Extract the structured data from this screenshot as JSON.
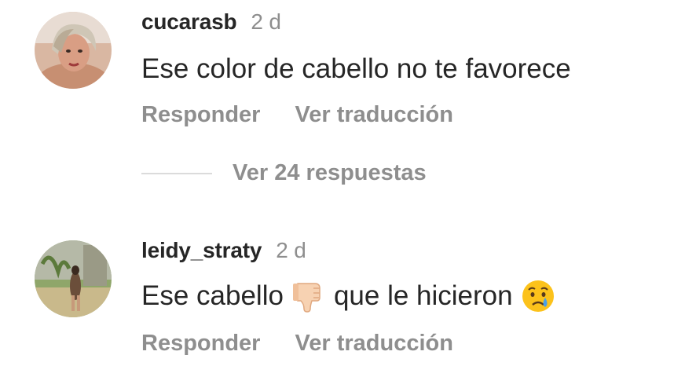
{
  "comments": [
    {
      "username": "cucarasb",
      "time": "2 d",
      "text": "Ese color de cabello no te favorece",
      "reply_label": "Responder",
      "translate_label": "Ver traducción"
    },
    {
      "username": "leidy_straty",
      "time": "2 d",
      "text_before": "Ese cabello",
      "emoji_1": "thumbs-down-emoji",
      "text_after": "que le hicieron",
      "emoji_2": "crying-face-emoji",
      "reply_label": "Responder",
      "translate_label": "Ver traducción"
    }
  ],
  "replies_toggle": {
    "label": "Ver 24 respuestas"
  }
}
